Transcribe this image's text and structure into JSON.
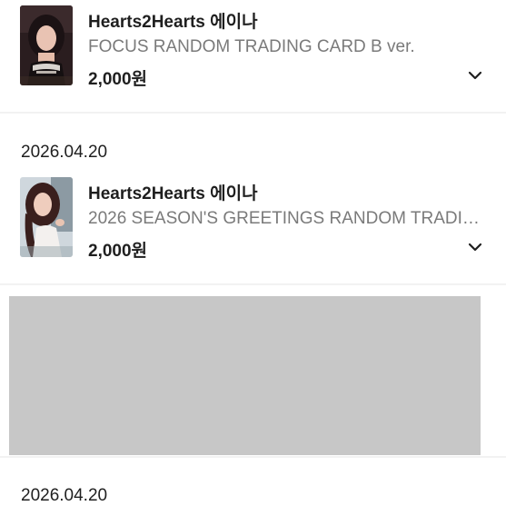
{
  "orders": [
    {
      "title": "Hearts2Hearts 에이나",
      "product": "FOCUS RANDOM TRADING CARD B ver.",
      "price": "2,000원",
      "thumbnail_icon": "photocard-thumbnail-icon",
      "expand_icon": "chevron-down-icon"
    },
    {
      "date": "2026.04.20",
      "title": "Hearts2Hearts 에이나",
      "product": "2026 SEASON'S GREETINGS RANDOM TRADING CARD",
      "price": "2,000원",
      "thumbnail_icon": "photocard-thumbnail-icon",
      "expand_icon": "chevron-down-icon"
    }
  ],
  "footer_date": "2026.04.20",
  "colors": {
    "text_primary": "#1f1f1f",
    "text_secondary": "#7a7a7a",
    "divider": "#f2f2f2",
    "redacted_block": "#c7c7c7"
  }
}
